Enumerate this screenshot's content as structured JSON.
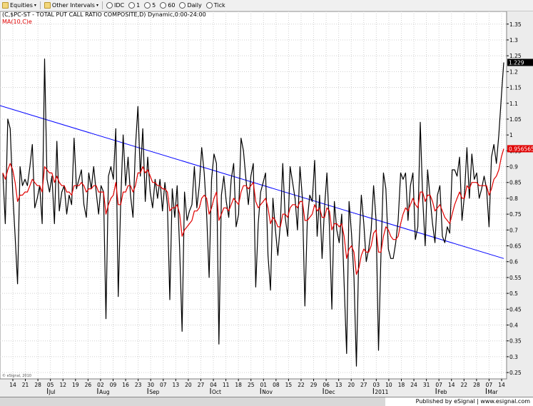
{
  "toolbar": {
    "items": [
      {
        "label": "Equities",
        "icon": "folder-icon",
        "caret": "▾"
      },
      {
        "label": "Other Intervals",
        "icon": "folder-icon",
        "caret": "▾"
      },
      {
        "label": "IDC",
        "icon": "clock-icon"
      },
      {
        "label": "1",
        "icon": "clock-icon"
      },
      {
        "label": "5",
        "icon": "clock-icon"
      },
      {
        "label": "60",
        "icon": "clock-icon"
      },
      {
        "label": "Daily",
        "icon": "clock-icon"
      },
      {
        "label": "Tick",
        "icon": "clock-icon"
      }
    ]
  },
  "footer": {
    "published": "Published by eSignal | www.esignal.com"
  },
  "colors": {
    "price": "#000000",
    "ma": "#e00000",
    "trendline": "#0000ff",
    "grid": "#c8c8c8",
    "background": "#ffffff"
  },
  "chart_data": {
    "type": "line",
    "header": "(C,$PC-ST - TOTAL PUT CALL RATIO COMPOSITE,D) Dynamic,0:00-24:00",
    "ma_label": "MA(10,C)e",
    "watermark": "© eSignal, 2010",
    "ylim": [
      0.23,
      1.39
    ],
    "y_ticks": [
      "0.25",
      "0.3",
      "0.35",
      "0.4",
      "0.45",
      "0.5",
      "0.55",
      "0.6",
      "0.65",
      "0.7",
      "0.75",
      "0.8",
      "0.85",
      "0.9",
      "0.95",
      "1",
      "1.05",
      "1.1",
      "1.15",
      "1.2",
      "1.25",
      "1.3",
      "1.35"
    ],
    "last_price": {
      "value": 1.229,
      "label": "1.229"
    },
    "last_ma": {
      "value": 0.956565,
      "label": "0.956565"
    },
    "date_ticks": [
      "14",
      "21",
      "28",
      "05",
      "12",
      "19",
      "26",
      "02",
      "09",
      "16",
      "23",
      "30",
      "07",
      "13",
      "20",
      "27",
      "04",
      "11",
      "18",
      "25",
      "01",
      "08",
      "15",
      "22",
      "29",
      "06",
      "13",
      "20",
      "27",
      "03",
      "10",
      "18",
      "24",
      "31",
      "07",
      "14",
      "22",
      "28",
      "07",
      "14"
    ],
    "month_labels": [
      {
        "label": "Jul",
        "tick": 3
      },
      {
        "label": "Aug",
        "tick": 7
      },
      {
        "label": "Sep",
        "tick": 11
      },
      {
        "label": "Oct",
        "tick": 16
      },
      {
        "label": "Nov",
        "tick": 20
      },
      {
        "label": "Dec",
        "tick": 25
      },
      {
        "label": "2011",
        "tick": 29
      },
      {
        "label": "Feb",
        "tick": 34
      },
      {
        "label": "Mar",
        "tick": 38
      }
    ],
    "grid": true,
    "series": [
      {
        "name": "$PC-ST",
        "values": [
          0.88,
          0.72,
          1.05,
          1.02,
          0.82,
          0.68,
          0.53,
          0.9,
          0.84,
          0.86,
          0.84,
          0.9,
          0.97,
          0.77,
          0.8,
          0.84,
          0.72,
          1.24,
          0.86,
          0.82,
          0.87,
          0.72,
          0.98,
          0.76,
          0.82,
          0.84,
          0.75,
          0.81,
          0.78,
          0.99,
          0.83,
          0.86,
          0.89,
          0.78,
          0.74,
          0.88,
          0.83,
          0.9,
          0.82,
          0.75,
          0.84,
          0.82,
          0.42,
          0.87,
          0.9,
          0.86,
          1.02,
          0.49,
          0.79,
          1.0,
          0.84,
          0.93,
          0.81,
          0.74,
          0.96,
          1.09,
          0.87,
          1.02,
          0.79,
          0.93,
          0.82,
          0.77,
          0.86,
          0.8,
          0.86,
          0.76,
          0.85,
          0.78,
          0.48,
          0.83,
          0.74,
          0.84,
          0.64,
          0.38,
          0.82,
          0.73,
          0.76,
          0.78,
          0.9,
          0.77,
          0.84,
          0.96,
          0.88,
          0.75,
          0.55,
          0.86,
          0.94,
          0.91,
          0.34,
          0.81,
          0.87,
          0.79,
          0.74,
          0.86,
          0.91,
          0.71,
          0.75,
          0.99,
          0.95,
          0.86,
          0.78,
          0.87,
          0.91,
          0.52,
          0.72,
          0.82,
          0.85,
          0.88,
          0.62,
          0.51,
          0.8,
          0.7,
          0.62,
          0.72,
          0.91,
          0.74,
          0.68,
          0.9,
          0.85,
          0.8,
          0.7,
          0.9,
          0.8,
          0.46,
          0.73,
          0.81,
          0.79,
          0.92,
          0.68,
          0.81,
          0.61,
          0.77,
          0.88,
          0.71,
          0.45,
          0.79,
          0.7,
          0.66,
          0.75,
          0.53,
          0.31,
          0.79,
          0.69,
          0.55,
          0.27,
          0.64,
          0.81,
          0.72,
          0.6,
          0.64,
          0.7,
          0.84,
          0.73,
          0.32,
          0.62,
          0.88,
          0.83,
          0.64,
          0.61,
          0.61,
          0.66,
          0.73,
          0.88,
          0.86,
          0.88,
          0.73,
          0.84,
          0.88,
          0.67,
          0.71,
          1.04,
          0.8,
          0.65,
          0.89,
          0.8,
          0.72,
          0.66,
          0.81,
          0.84,
          0.68,
          0.66,
          0.71,
          0.69,
          0.89,
          0.89,
          0.87,
          0.93,
          0.73,
          0.81,
          0.96,
          0.8,
          0.94,
          0.86,
          0.88,
          0.8,
          0.83,
          0.87,
          0.83,
          0.71,
          0.93,
          0.97,
          0.91,
          1.0,
          1.12,
          1.229
        ]
      },
      {
        "name": "MA(10,C)e",
        "values": [
          0.88,
          0.86,
          0.89,
          0.91,
          0.89,
          0.85,
          0.79,
          0.81,
          0.81,
          0.82,
          0.82,
          0.84,
          0.86,
          0.85,
          0.84,
          0.84,
          0.82,
          0.9,
          0.89,
          0.88,
          0.88,
          0.85,
          0.87,
          0.85,
          0.84,
          0.84,
          0.82,
          0.82,
          0.81,
          0.84,
          0.84,
          0.84,
          0.85,
          0.84,
          0.82,
          0.83,
          0.83,
          0.84,
          0.84,
          0.82,
          0.82,
          0.82,
          0.75,
          0.78,
          0.8,
          0.81,
          0.85,
          0.78,
          0.78,
          0.82,
          0.82,
          0.84,
          0.84,
          0.82,
          0.84,
          0.88,
          0.88,
          0.9,
          0.88,
          0.89,
          0.87,
          0.85,
          0.85,
          0.84,
          0.84,
          0.83,
          0.83,
          0.82,
          0.76,
          0.77,
          0.77,
          0.78,
          0.75,
          0.68,
          0.7,
          0.71,
          0.72,
          0.73,
          0.76,
          0.76,
          0.77,
          0.8,
          0.81,
          0.8,
          0.75,
          0.77,
          0.8,
          0.82,
          0.73,
          0.75,
          0.77,
          0.77,
          0.76,
          0.78,
          0.8,
          0.79,
          0.78,
          0.82,
          0.84,
          0.84,
          0.83,
          0.84,
          0.85,
          0.79,
          0.77,
          0.78,
          0.79,
          0.8,
          0.77,
          0.72,
          0.74,
          0.73,
          0.71,
          0.71,
          0.75,
          0.75,
          0.74,
          0.77,
          0.78,
          0.78,
          0.77,
          0.79,
          0.79,
          0.73,
          0.73,
          0.74,
          0.75,
          0.78,
          0.76,
          0.77,
          0.74,
          0.74,
          0.77,
          0.76,
          0.7,
          0.72,
          0.72,
          0.71,
          0.72,
          0.68,
          0.61,
          0.64,
          0.65,
          0.63,
          0.56,
          0.58,
          0.62,
          0.64,
          0.63,
          0.63,
          0.65,
          0.69,
          0.7,
          0.63,
          0.63,
          0.68,
          0.71,
          0.7,
          0.68,
          0.67,
          0.67,
          0.68,
          0.72,
          0.75,
          0.77,
          0.76,
          0.78,
          0.8,
          0.78,
          0.77,
          0.82,
          0.82,
          0.79,
          0.81,
          0.81,
          0.79,
          0.76,
          0.77,
          0.78,
          0.76,
          0.74,
          0.73,
          0.72,
          0.75,
          0.78,
          0.8,
          0.82,
          0.8,
          0.8,
          0.84,
          0.83,
          0.85,
          0.85,
          0.85,
          0.84,
          0.84,
          0.84,
          0.84,
          0.81,
          0.83,
          0.86,
          0.87,
          0.89,
          0.93,
          0.956565
        ]
      }
    ],
    "trendline": {
      "name": "trend",
      "from": {
        "index": 0,
        "value": 1.09
      },
      "to": {
        "index": 199,
        "value": 0.61
      }
    }
  }
}
